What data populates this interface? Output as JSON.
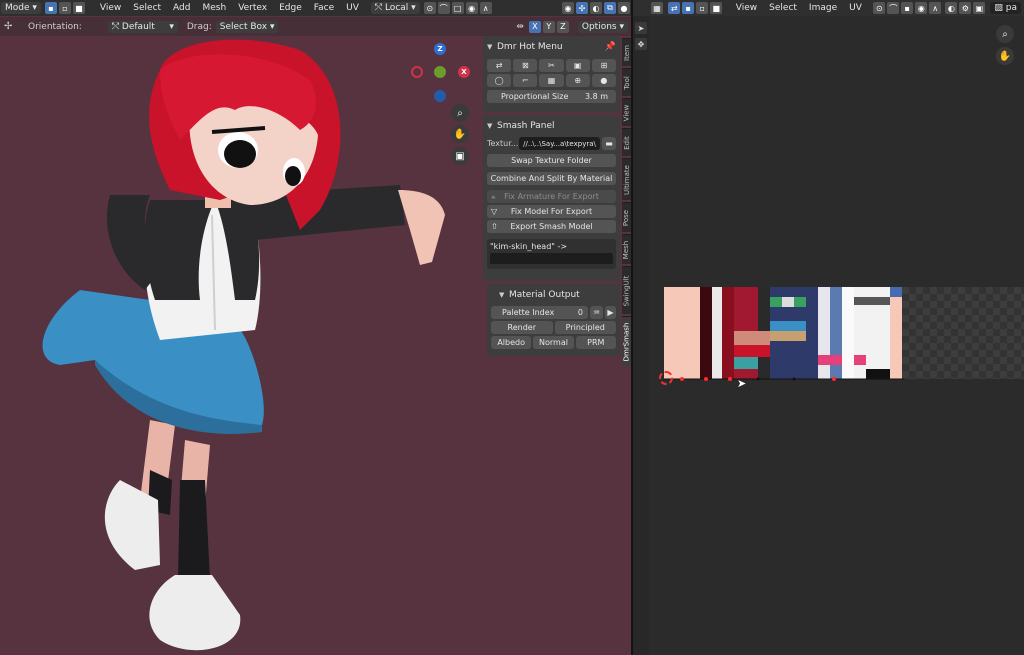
{
  "viewport": {
    "header": {
      "mode_label": "Mode",
      "menus": [
        "View",
        "Select",
        "Add",
        "Mesh",
        "Vertex",
        "Edge",
        "Face",
        "UV"
      ],
      "transform_orientation": "Local"
    },
    "tool_header": {
      "orientation_label": "Orientation:",
      "orientation_value": "Default",
      "drag_label": "Drag:",
      "drag_value": "Select Box",
      "axis_buttons": [
        "X",
        "Y",
        "Z"
      ],
      "options_label": "Options"
    },
    "gizmo": {
      "z": "Z",
      "x": "X"
    }
  },
  "npanel": {
    "hot_menu": {
      "title": "Dmr Hot Menu",
      "proportional_label": "Proportional Size",
      "proportional_value": "3.8 m"
    },
    "smash_panel": {
      "title": "Smash Panel",
      "texture_label": "Textur...",
      "texture_path": "//..\\..\\Say...a\\texpyra\\",
      "swap_texture": "Swap Texture Folder",
      "combine_split": "Combine And Split By Material",
      "fix_armature": "Fix Armature For Export",
      "fix_model": "Fix Model For Export",
      "export_model": "Export Smash Model",
      "material_ref": "\"kim-skin_head\" ->"
    },
    "material_output": {
      "title": "Material Output",
      "palette_label": "Palette Index",
      "palette_value": "0",
      "render": "Render",
      "principled": "Principled",
      "albedo": "Albedo",
      "normal": "Normal",
      "prm": "PRM"
    },
    "tabs": [
      "Item",
      "Tool",
      "View",
      "Edit",
      "Ultimate",
      "Pose",
      "Mesh",
      "SwingUlt",
      "DmrSmash"
    ]
  },
  "uv_editor": {
    "menus": [
      "View",
      "Select",
      "Image",
      "UV"
    ],
    "image_name": "pa"
  },
  "colors": {
    "viewport_bg": "#56333f",
    "hair": "#c8132b",
    "skirt": "#3a8fc4",
    "accent": "#4772b3"
  }
}
